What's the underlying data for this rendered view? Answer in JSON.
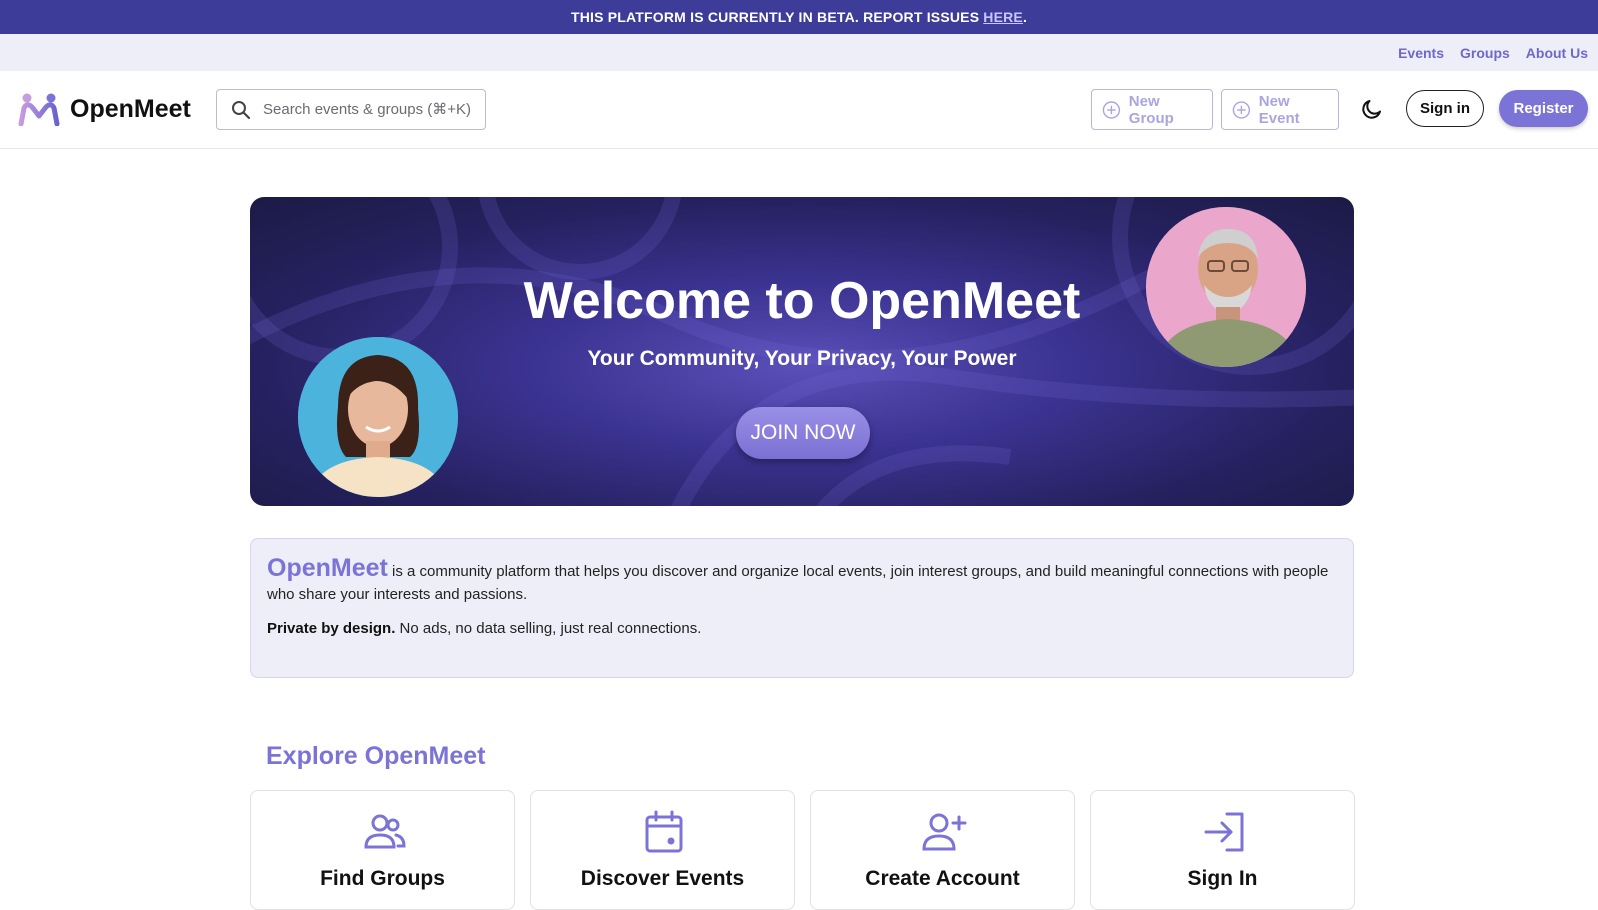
{
  "beta_banner": {
    "text": "THIS PLATFORM IS CURRENTLY IN BETA. REPORT ISSUES",
    "link": "HERE",
    "suffix": "."
  },
  "top_nav": {
    "events": "Events",
    "groups": "Groups",
    "about": "About Us"
  },
  "header": {
    "logo_text": "OpenMeet",
    "search_placeholder": "Search events & groups (⌘+K)",
    "new_group": "New Group",
    "new_event": "New Event",
    "sign_in": "Sign in",
    "register": "Register"
  },
  "hero": {
    "title": "Welcome to OpenMeet",
    "subtitle": "Your Community, Your Privacy, Your Power",
    "cta": "JOIN NOW"
  },
  "about": {
    "brand": "OpenMeet",
    "description": " is a community platform that helps you discover and organize local events, join interest groups, and build meaningful connections with people who share your interests and passions.",
    "private_bold": "Private by design.",
    "private_text": " No ads, no data selling, just real connections."
  },
  "explore": {
    "title": "Explore OpenMeet",
    "cards": [
      {
        "label": "Find Groups",
        "icon": "users-icon"
      },
      {
        "label": "Discover Events",
        "icon": "calendar-icon"
      },
      {
        "label": "Create Account",
        "icon": "add-user-icon"
      },
      {
        "label": "Sign In",
        "icon": "login-icon"
      }
    ]
  },
  "colors": {
    "accent": "#7b73d6",
    "banner": "#3d3c99",
    "hero_dark": "#1c1a45"
  }
}
